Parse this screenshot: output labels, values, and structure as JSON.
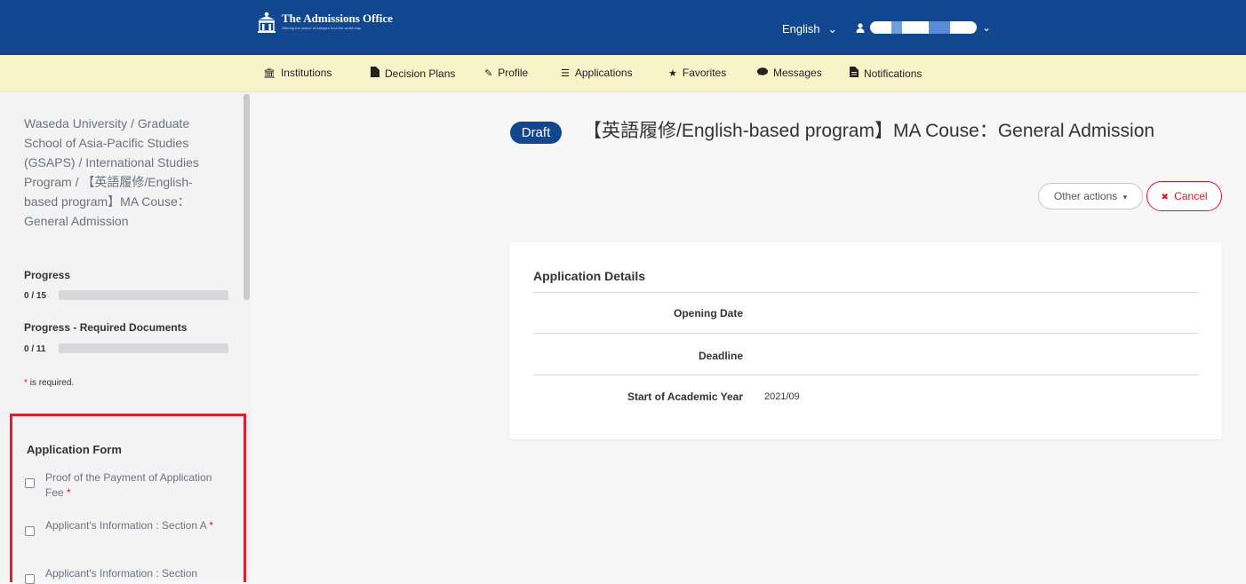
{
  "header": {
    "logo_title": "The Admissions Office",
    "logo_tagline": "Offering the choice of colleges from the world map",
    "language": "English",
    "language_caret": "⌄",
    "user_caret": "⌄",
    "user_icon": "user-icon",
    "brand_color": "#11478f"
  },
  "nav": {
    "items": [
      {
        "label": "Institutions",
        "icon": "institution-icon",
        "glyph": "🏛"
      },
      {
        "label": "Decision Plans",
        "icon": "file-icon",
        "glyph": "▪"
      },
      {
        "label": "Profile",
        "icon": "edit-icon",
        "glyph": "✎"
      },
      {
        "label": "Applications",
        "icon": "list-icon",
        "glyph": "☰"
      },
      {
        "label": "Favorites",
        "icon": "star-icon",
        "glyph": "★"
      },
      {
        "label": "Messages",
        "icon": "chat-icon",
        "glyph": "●"
      },
      {
        "label": "Notifications",
        "icon": "notification-file-icon",
        "glyph": "▤"
      }
    ],
    "background": "#f8f3c8"
  },
  "sidebar": {
    "breadcrumb": "Waseda University / Graduate School of Asia-Pacific Studies (GSAPS) / International Studies Program / 【英語履修/English-based program】MA Couse：General Admission",
    "progress": {
      "label": "Progress",
      "count": "0 / 15",
      "value": 0
    },
    "progress_required": {
      "label": "Progress - Required Documents",
      "count": "0 / 11",
      "value": 0
    },
    "required_note": "is required.",
    "required_star": "*",
    "form_section": {
      "title": "Application Form",
      "items": [
        {
          "label": "Proof of the Payment of Application Fee",
          "required": "*"
        },
        {
          "label": "Applicant's Information : Section A",
          "required": "*"
        },
        {
          "label": "Applicant's Information : Section",
          "required": ""
        }
      ]
    }
  },
  "main": {
    "status_badge": "Draft",
    "title": "【英語履修/English-based program】MA Couse：General Admission",
    "other_actions_label": "Other actions",
    "other_actions_caret": "▾",
    "cancel_label": "Cancel",
    "cancel_icon": "✖",
    "details": {
      "title": "Application Details",
      "rows": [
        {
          "label": "Opening Date",
          "value": ""
        },
        {
          "label": "Deadline",
          "value": ""
        },
        {
          "label": "Start of Academic Year",
          "value": "2021/09"
        }
      ]
    }
  },
  "colors": {
    "accent": "#11478f",
    "danger": "#d9152a",
    "highlight_border": "#dd1f2f"
  }
}
